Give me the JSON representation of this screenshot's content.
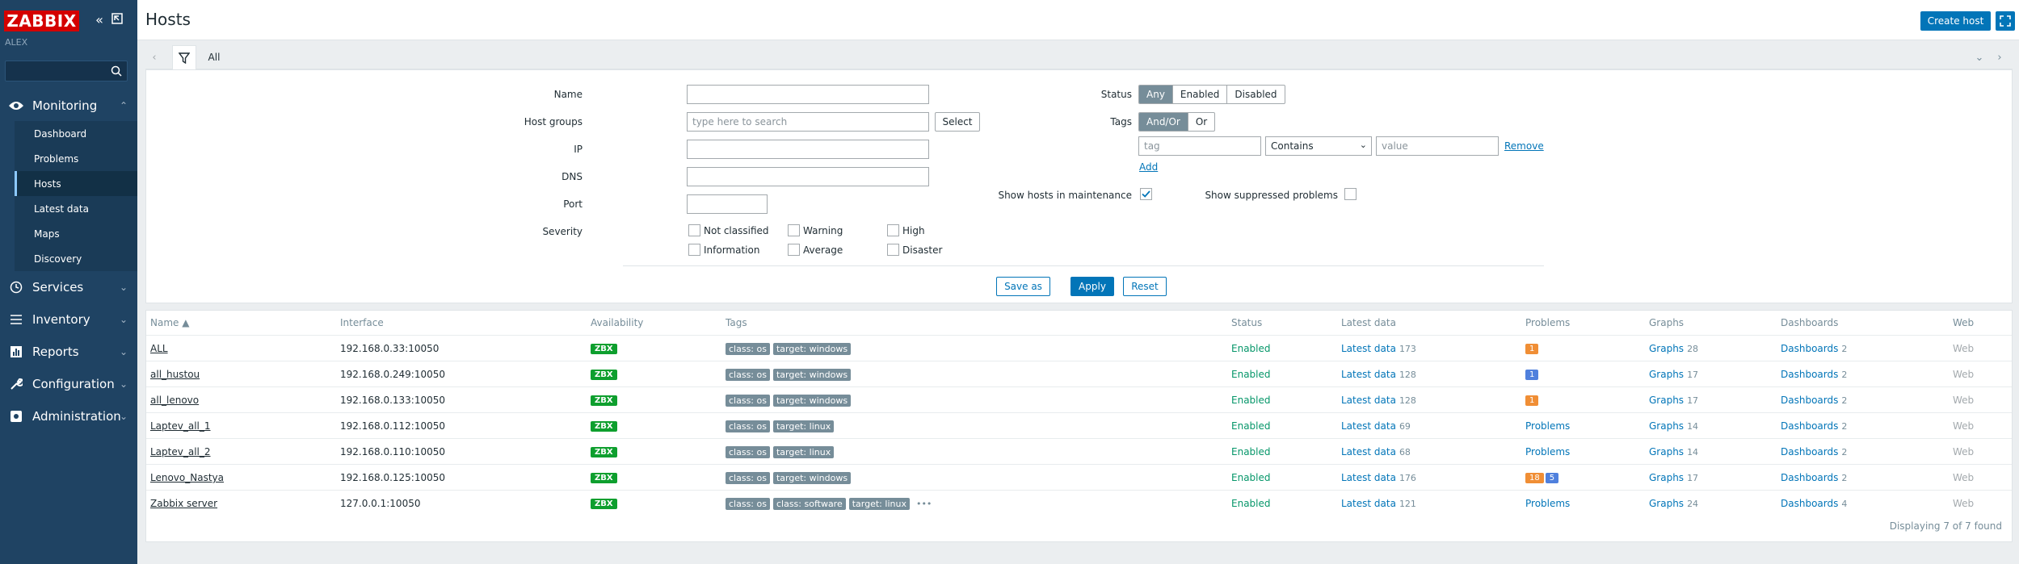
{
  "sidebar": {
    "logo": "ZABBIX",
    "server_name": "ALEX",
    "search_value": "",
    "sections": [
      {
        "label": "Monitoring"
      },
      {
        "label": "Services"
      },
      {
        "label": "Inventory"
      },
      {
        "label": "Reports"
      },
      {
        "label": "Configuration"
      },
      {
        "label": "Administration"
      }
    ],
    "monitoring_items": [
      {
        "label": "Dashboard"
      },
      {
        "label": "Problems"
      },
      {
        "label": "Hosts"
      },
      {
        "label": "Latest data"
      },
      {
        "label": "Maps"
      },
      {
        "label": "Discovery"
      }
    ]
  },
  "header": {
    "title": "Hosts",
    "create_host_label": "Create host"
  },
  "filter_tabs": {
    "all_label": "All"
  },
  "filter": {
    "name_label": "Name",
    "name_value": "",
    "host_groups_label": "Host groups",
    "host_groups_placeholder": "type here to search",
    "select_label": "Select",
    "ip_label": "IP",
    "dns_label": "DNS",
    "port_label": "Port",
    "severity_label": "Severity",
    "severities": [
      "Not classified",
      "Warning",
      "High",
      "Information",
      "Average",
      "Disaster"
    ],
    "status_label": "Status",
    "status_options": [
      "Any",
      "Enabled",
      "Disabled"
    ],
    "tags_label": "Tags",
    "tags_options": [
      "And/Or",
      "Or"
    ],
    "tag_placeholder": "tag",
    "tag_operator": "Contains",
    "value_placeholder": "value",
    "remove_label": "Remove",
    "add_label": "Add",
    "maintenance_label": "Show hosts in maintenance",
    "suppressed_label": "Show suppressed problems",
    "save_as_label": "Save as",
    "apply_label": "Apply",
    "reset_label": "Reset"
  },
  "table": {
    "headers": {
      "name": "Name ▲",
      "interface": "Interface",
      "availability": "Availability",
      "tags": "Tags",
      "status": "Status",
      "latest_data": "Latest data",
      "problems": "Problems",
      "graphs": "Graphs",
      "dashboards": "Dashboards",
      "web": "Web"
    },
    "rows": [
      {
        "name": "ALL",
        "interface": "192.168.0.33:10050",
        "availability": "ZBX",
        "tags": [
          "class: os",
          "target: windows"
        ],
        "more_tags": "",
        "status": "Enabled",
        "latest_label": "Latest data",
        "latest_count": "173",
        "problems_label": "",
        "problem_badges": [
          {
            "value": "1",
            "color": "#f08e35"
          }
        ],
        "graphs_label": "Graphs",
        "graphs_count": "28",
        "dashboards_label": "Dashboards",
        "dashboards_count": "2",
        "web": "Web"
      },
      {
        "name": "all_hustou",
        "interface": "192.168.0.249:10050",
        "availability": "ZBX",
        "tags": [
          "class: os",
          "target: windows"
        ],
        "more_tags": "",
        "status": "Enabled",
        "latest_label": "Latest data",
        "latest_count": "128",
        "problems_label": "",
        "problem_badges": [
          {
            "value": "1",
            "color": "#4f80dd"
          }
        ],
        "graphs_label": "Graphs",
        "graphs_count": "17",
        "dashboards_label": "Dashboards",
        "dashboards_count": "2",
        "web": "Web"
      },
      {
        "name": "all_lenovo",
        "interface": "192.168.0.133:10050",
        "availability": "ZBX",
        "tags": [
          "class: os",
          "target: windows"
        ],
        "more_tags": "",
        "status": "Enabled",
        "latest_label": "Latest data",
        "latest_count": "128",
        "problems_label": "",
        "problem_badges": [
          {
            "value": "1",
            "color": "#f08e35"
          }
        ],
        "graphs_label": "Graphs",
        "graphs_count": "17",
        "dashboards_label": "Dashboards",
        "dashboards_count": "2",
        "web": "Web"
      },
      {
        "name": "Laptev_all_1",
        "interface": "192.168.0.112:10050",
        "availability": "ZBX",
        "tags": [
          "class: os",
          "target: linux"
        ],
        "more_tags": "",
        "status": "Enabled",
        "latest_label": "Latest data",
        "latest_count": "69",
        "problems_label": "Problems",
        "problem_badges": [],
        "graphs_label": "Graphs",
        "graphs_count": "14",
        "dashboards_label": "Dashboards",
        "dashboards_count": "2",
        "web": "Web"
      },
      {
        "name": "Laptev_all_2",
        "interface": "192.168.0.110:10050",
        "availability": "ZBX",
        "tags": [
          "class: os",
          "target: linux"
        ],
        "more_tags": "",
        "status": "Enabled",
        "latest_label": "Latest data",
        "latest_count": "68",
        "problems_label": "Problems",
        "problem_badges": [],
        "graphs_label": "Graphs",
        "graphs_count": "14",
        "dashboards_label": "Dashboards",
        "dashboards_count": "2",
        "web": "Web"
      },
      {
        "name": "Lenovo_Nastya",
        "interface": "192.168.0.125:10050",
        "availability": "ZBX",
        "tags": [
          "class: os",
          "target: windows"
        ],
        "more_tags": "",
        "status": "Enabled",
        "latest_label": "Latest data",
        "latest_count": "176",
        "problems_label": "",
        "problem_badges": [
          {
            "value": "18",
            "color": "#f08e35"
          },
          {
            "value": "5",
            "color": "#4f80dd"
          }
        ],
        "graphs_label": "Graphs",
        "graphs_count": "17",
        "dashboards_label": "Dashboards",
        "dashboards_count": "2",
        "web": "Web"
      },
      {
        "name": "Zabbix server",
        "interface": "127.0.0.1:10050",
        "availability": "ZBX",
        "tags": [
          "class: os",
          "class: software",
          "target: linux"
        ],
        "more_tags": "•••",
        "status": "Enabled",
        "latest_label": "Latest data",
        "latest_count": "121",
        "problems_label": "Problems",
        "problem_badges": [],
        "graphs_label": "Graphs",
        "graphs_count": "24",
        "dashboards_label": "Dashboards",
        "dashboards_count": "4",
        "web": "Web"
      }
    ],
    "footer": "Displaying 7 of 7 found"
  }
}
